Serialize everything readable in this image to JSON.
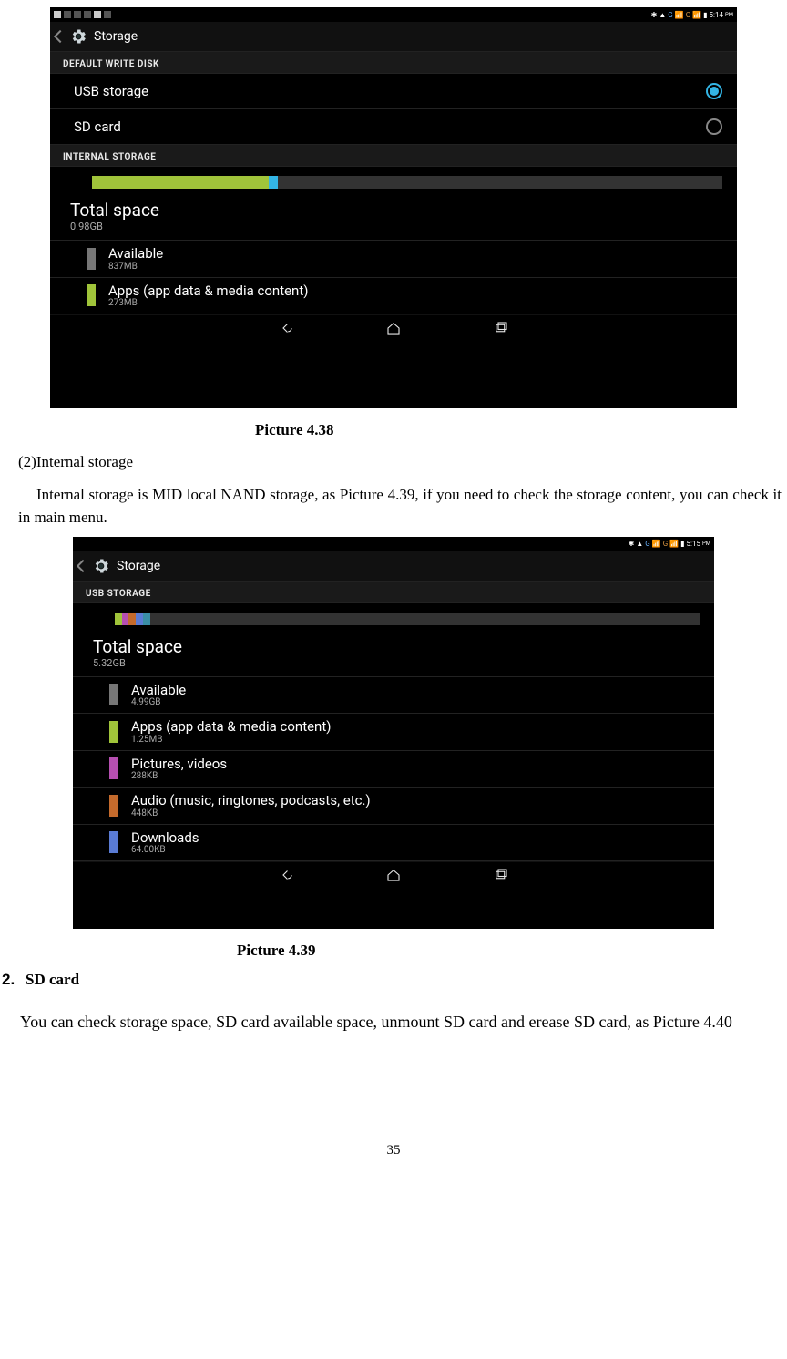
{
  "screenshot1": {
    "time": "5:14",
    "time_suffix": "PM",
    "net1": "G",
    "net2": "G",
    "title": "Storage",
    "section_default": "DEFAULT WRITE DISK",
    "usb_label": "USB storage",
    "sd_label": "SD card",
    "section_internal": "INTERNAL STORAGE",
    "total_label": "Total space",
    "total_value": "0.98GB",
    "items": [
      {
        "color": "#777777",
        "title": "Available",
        "value": "837MB"
      },
      {
        "color": "#a0c43a",
        "title": "Apps (app data & media content)",
        "value": "273MB"
      }
    ],
    "bar_segments": [
      {
        "color": "#a0c43a",
        "pct": 28
      },
      {
        "color": "#33b5e5",
        "pct": 1.5
      }
    ]
  },
  "screenshot2": {
    "time": "5:15",
    "time_suffix": "PM",
    "net1": "G",
    "net2": "G",
    "title": "Storage",
    "section_usb": "USB STORAGE",
    "total_label": "Total space",
    "total_value": "5.32GB",
    "items": [
      {
        "color": "#777777",
        "title": "Available",
        "value": "4.99GB"
      },
      {
        "color": "#a0c43a",
        "title": "Apps (app data & media content)",
        "value": "1.25MB"
      },
      {
        "color": "#b64fb1",
        "title": "Pictures, videos",
        "value": "288KB"
      },
      {
        "color": "#c46a2c",
        "title": "Audio (music, ringtones, podcasts, etc.)",
        "value": "448KB"
      },
      {
        "color": "#5a7bd4",
        "title": "Downloads",
        "value": "64.00KB"
      }
    ],
    "bar_segments": [
      {
        "color": "#a0c43a",
        "pct": 1.2
      },
      {
        "color": "#b64fb1",
        "pct": 1.2
      },
      {
        "color": "#c46a2c",
        "pct": 1.2
      },
      {
        "color": "#5a7bd4",
        "pct": 1.2
      },
      {
        "color": "#3a8ea6",
        "pct": 1.2
      }
    ]
  },
  "doc": {
    "caption1": "Picture 4.38",
    "p1": "(2)Internal storage",
    "p2": "Internal storage is MID local NAND storage, as Picture 4.39, if you need to check the storage content, you can check it in main menu.",
    "caption2": "Picture 4.39",
    "list_num": "2.",
    "list_label": "SD card",
    "p3": "You can check storage space, SD card available space, unmount SD card and erease SD card, as Picture 4.40",
    "page_number": "35"
  }
}
